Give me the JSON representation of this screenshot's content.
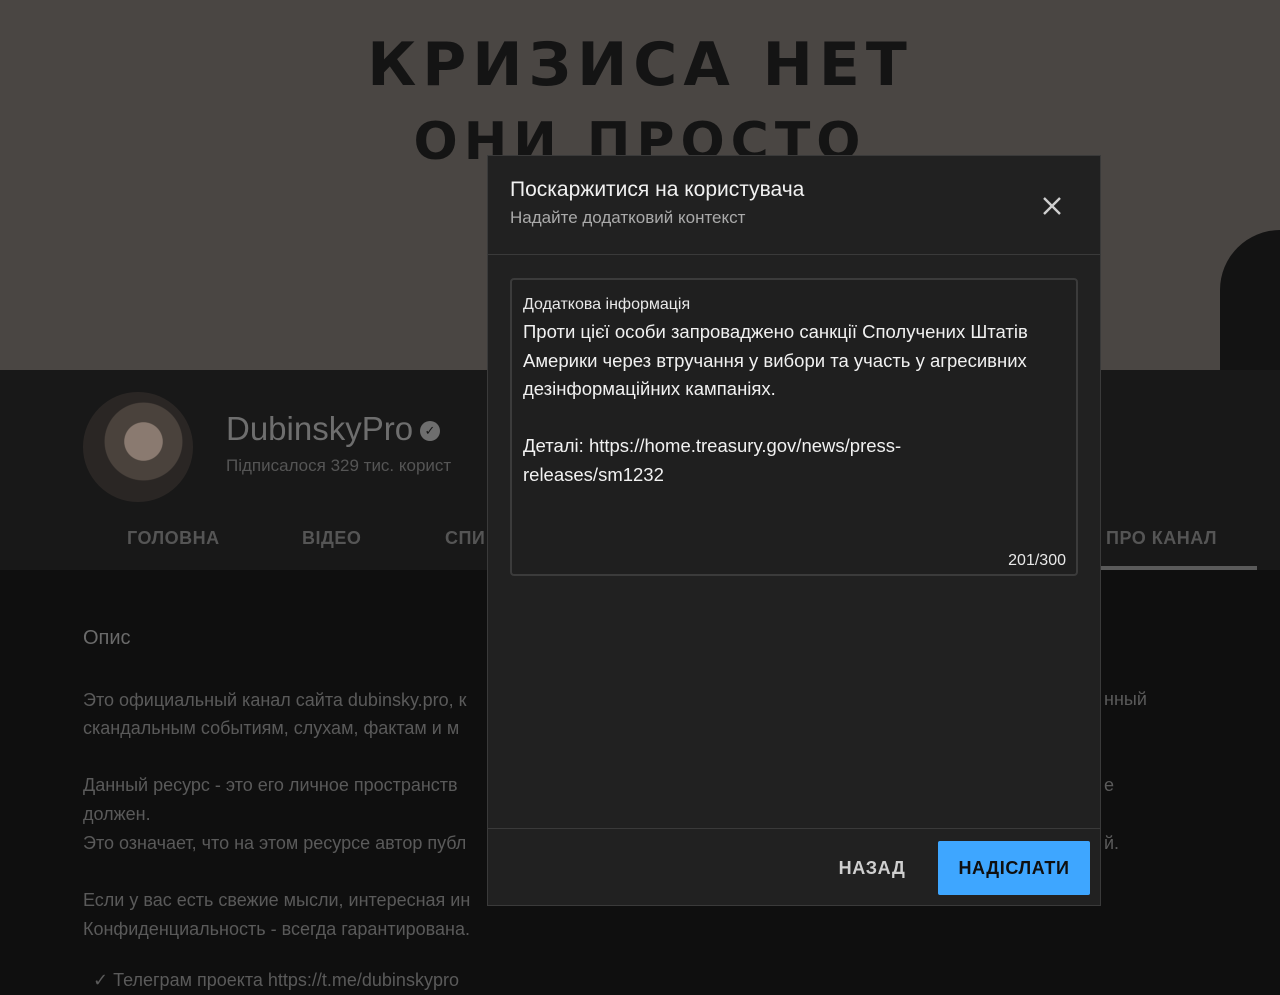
{
  "banner": {
    "line1": "КРИЗИСА НЕТ",
    "line2": "ОНИ ПРОСТО"
  },
  "channel": {
    "name": "DubinskyPro",
    "subscribers": "Підписалося 329 тис. корист"
  },
  "tabs": [
    {
      "label": "ГОЛОВНА"
    },
    {
      "label": "ВІДЕО"
    },
    {
      "label": "СПИ"
    },
    {
      "label": "ПРО КАНАЛ"
    }
  ],
  "about": {
    "heading": "Опис",
    "p1": [
      "Это официальный канал сайта dubinsky.pro, к",
      "скандальным событиям, слухам, фактам и м"
    ],
    "p1_right": "нный",
    "p2": [
      "Данный ресурс - это его  личное пространств",
      "должен.",
      "Это означает, что на этом ресурсе автор публ"
    ],
    "p2_right": [
      "е",
      "й."
    ],
    "p3": [
      "Если у вас есть свежие мысли, интересная ин",
      "Конфиденциальность - всегда гарантирована."
    ],
    "p4": "✓ Телеграм проекта https://t.me/dubinskypro"
  },
  "dialog": {
    "title": "Поскаржитися на користувача",
    "subtitle": "Надайте додатковий контекст",
    "field_label": "Додаткова інформація",
    "field_value": "Проти цієї особи запроваджено санкції Сполучених Штатів\nАмерики через втручання у вибори та участь у агресивних\nдезінформаційних кампаніях.\n\nДеталі: https://home.treasury.gov/news/press-\nreleases/sm1232",
    "counter": "201/300",
    "back_label": "НАЗАД",
    "send_label": "НАДІСЛАТИ"
  },
  "colors": {
    "accent": "#3ea6ff",
    "dialog_bg": "#212121"
  }
}
